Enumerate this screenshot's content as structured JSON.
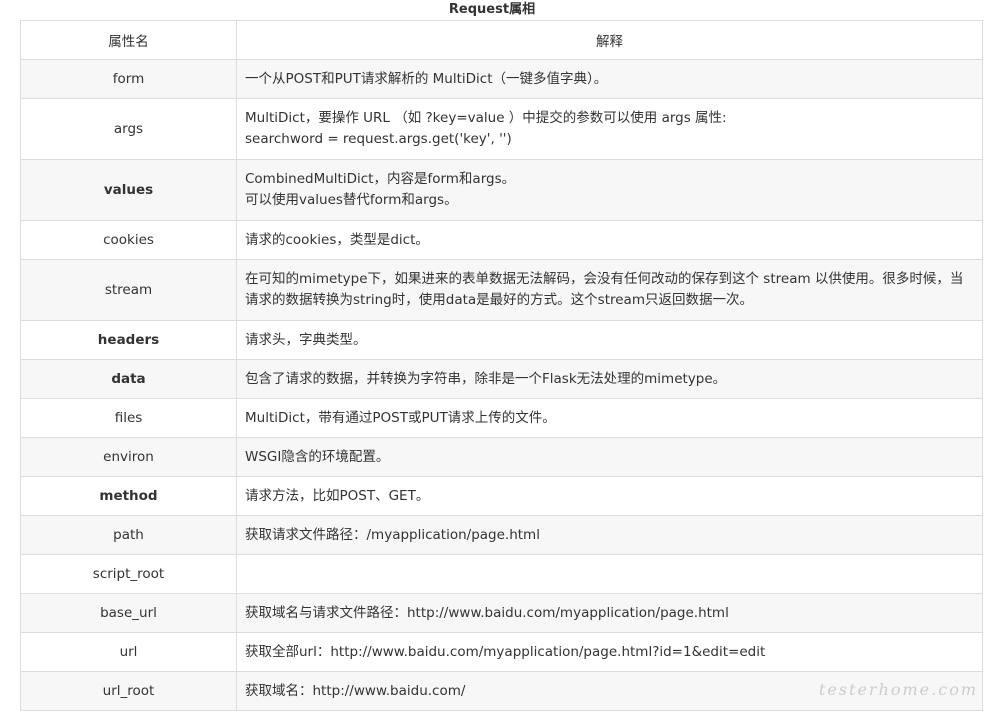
{
  "caption": "Request属相",
  "headers": {
    "name": "属性名",
    "desc": "解释"
  },
  "rows": [
    {
      "name": "form",
      "bold": false,
      "lines": [
        "一个从POST和PUT请求解析的 MultiDict（一键多值字典）。"
      ]
    },
    {
      "name": "args",
      "bold": false,
      "lines": [
        "MultiDict，要操作 URL （如 ?key=value ）中提交的参数可以使用 args 属性:",
        "searchword = request.args.get('key', '')"
      ]
    },
    {
      "name": "values",
      "bold": true,
      "lines": [
        "CombinedMultiDict，内容是form和args。",
        "可以使用values替代form和args。"
      ]
    },
    {
      "name": "cookies",
      "bold": false,
      "lines": [
        "请求的cookies，类型是dict。"
      ]
    },
    {
      "name": "stream",
      "bold": false,
      "lines": [
        "在可知的mimetype下，如果进来的表单数据无法解码，会没有任何改动的保存到这个 stream 以供使用。很多时候，当",
        "请求的数据转换为string时，使用data是最好的方式。这个stream只返回数据一次。"
      ]
    },
    {
      "name": "headers",
      "bold": true,
      "lines": [
        "请求头，字典类型。"
      ]
    },
    {
      "name": "data",
      "bold": true,
      "lines": [
        "包含了请求的数据，并转换为字符串，除非是一个Flask无法处理的mimetype。"
      ]
    },
    {
      "name": "files",
      "bold": false,
      "lines": [
        "MultiDict，带有通过POST或PUT请求上传的文件。"
      ]
    },
    {
      "name": "environ",
      "bold": false,
      "lines": [
        "WSGI隐含的环境配置。"
      ]
    },
    {
      "name": "method",
      "bold": true,
      "lines": [
        "请求方法，比如POST、GET。"
      ]
    },
    {
      "name": "path",
      "bold": false,
      "lines": [
        "获取请求文件路径：/myapplication/page.html"
      ]
    },
    {
      "name": "script_root",
      "bold": false,
      "lines": []
    },
    {
      "name": "base_url",
      "bold": false,
      "lines": [
        "获取域名与请求文件路径：http://www.baidu.com/myapplication/page.html"
      ]
    },
    {
      "name": "url",
      "bold": false,
      "lines": [
        "获取全部url：http://www.baidu.com/myapplication/page.html?id=1&edit=edit"
      ]
    },
    {
      "name": "url_root",
      "bold": false,
      "lines": [
        "获取域名：http://www.baidu.com/"
      ]
    }
  ],
  "watermark": "testerhome.com"
}
